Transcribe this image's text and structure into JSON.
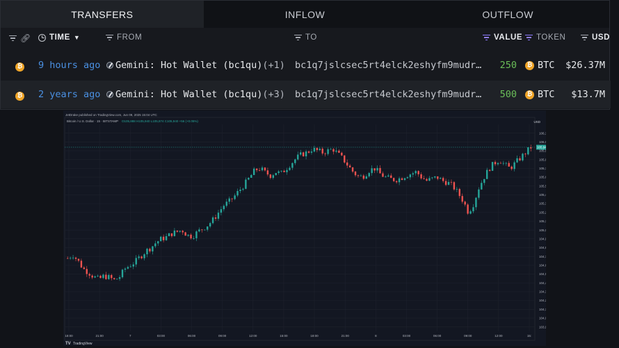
{
  "tabs": [
    {
      "label": "TRANSFERS",
      "active": true
    },
    {
      "label": "INFLOW",
      "active": false
    },
    {
      "label": "OUTFLOW",
      "active": false
    }
  ],
  "columns": {
    "time": "TIME",
    "from": "FROM",
    "to": "TO",
    "value": "VALUE",
    "token": "TOKEN",
    "usd": "USD"
  },
  "rows": [
    {
      "time": "9 hours ago",
      "from": "Gemini: Hot Wallet (bc1qu)",
      "from_extra": "(+1)",
      "to": "bc1q7jslcsec5rt4elck2eshyfm9mudr…",
      "value": "250",
      "token": "BTC",
      "usd": "$26.37M"
    },
    {
      "time": "2 years ago",
      "from": "Gemini: Hot Wallet (bc1qu)",
      "from_extra": "(+3)",
      "to": "bc1q7jslcsec5rt4elck2eshyfm9mudr…",
      "value": "500",
      "token": "BTC",
      "usd": "$13.7M"
    }
  ],
  "token_icon_letter": "₿",
  "chart": {
    "published_by": "JetDrake published on TradingView.com, Jun 09, 2025 15:04 UTC",
    "symbol_line": "Bitcoin / U.S. Dollar · 15 · BITSTAMP",
    "ohlc": "O105,888 H105,940 L105,874 C105,940 +56 (+0.05%)",
    "currency": "USD",
    "last_price": "105,940",
    "brand": "TradingView",
    "y_ticks": [
      "106,100",
      "106,000",
      "105,900",
      "105,800",
      "105,700",
      "105,600",
      "105,500",
      "105,400",
      "105,300",
      "105,200",
      "105,100",
      "105,000",
      "104,900",
      "104,800",
      "104,700",
      "104,600",
      "104,500",
      "104,400",
      "104,300",
      "104,200",
      "104,100",
      "104,000",
      "103,900"
    ],
    "x_ticks": [
      "18:00",
      "21:00",
      "7",
      "03:00",
      "06:00",
      "09:00",
      "12:00",
      "15:00",
      "18:00",
      "21:00",
      "8",
      "03:00",
      "06:00",
      "09:00",
      "12:00",
      "15:"
    ],
    "up_color": "#26a69a",
    "down_color": "#ef5350"
  },
  "chart_data": {
    "type": "candlestick",
    "title": "Bitcoin / U.S. Dollar · 15 · BITSTAMP",
    "ylim": [
      103850,
      106200
    ],
    "close_path": [
      104680,
      104720,
      104650,
      104560,
      104520,
      104470,
      104440,
      104480,
      104460,
      104430,
      104470,
      104560,
      104600,
      104640,
      104700,
      104760,
      104800,
      104860,
      104900,
      104920,
      104960,
      104980,
      105000,
      104940,
      104930,
      104980,
      105020,
      105060,
      105120,
      105200,
      105280,
      105320,
      105380,
      105450,
      105520,
      105600,
      105680,
      105700,
      105650,
      105620,
      105660,
      105640,
      105700,
      105760,
      105820,
      105860,
      105880,
      105920,
      105900,
      105880,
      105900,
      105920,
      105860,
      105800,
      105720,
      105650,
      105600,
      105620,
      105680,
      105700,
      105640,
      105600,
      105580,
      105570,
      105590,
      105620,
      105640,
      105660,
      105600,
      105560,
      105580,
      105600,
      105560,
      105540,
      105500,
      105420,
      105330,
      105200,
      105300,
      105480,
      105600,
      105700,
      105760,
      105800,
      105740,
      105700,
      105760,
      105820,
      105880,
      105940
    ]
  }
}
